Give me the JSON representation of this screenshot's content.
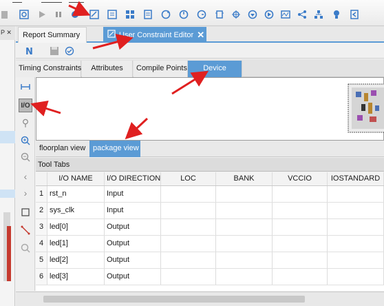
{
  "toolbar": {
    "icons": [
      "open-icon",
      "run-icon",
      "pause-icon",
      "settings-gear-icon",
      "edit-icon",
      "report-icon",
      "chip-icon",
      "hierarchy-icon",
      "document-icon",
      "refresh-icon",
      "cycle-icon",
      "clock-icon",
      "debug-icon",
      "bug-icon",
      "download-icon",
      "export-icon",
      "wave-icon",
      "share-icon",
      "tree-icon",
      "bulb-icon",
      "flag-icon"
    ]
  },
  "left_strip": {
    "header_text": "P ✕"
  },
  "tabs": {
    "report_summary": "Report Summary",
    "active_label": "User Constraint Editor",
    "close": "✕"
  },
  "editor_toolbar": {
    "icons": [
      "new-icon",
      "save-icon",
      "check-icon"
    ]
  },
  "subtabs": {
    "timing": "Timing Constraints",
    "attributes": "Attributes",
    "compile_points": "Compile Points",
    "device": "Device"
  },
  "vcol": {
    "io_label": "I/O"
  },
  "view_tabs": {
    "floorplan": "floorplan view",
    "package": "package view"
  },
  "tool_tabs": {
    "label": "Tool Tabs"
  },
  "table": {
    "headers": [
      "I/O NAME",
      "I/O DIRECTION",
      "LOC",
      "BANK",
      "VCCIO",
      "IOSTANDARD"
    ],
    "rows": [
      {
        "num": "1",
        "name": "rst_n",
        "dir": "Input"
      },
      {
        "num": "2",
        "name": "sys_clk",
        "dir": "Input"
      },
      {
        "num": "3",
        "name": "led[0]",
        "dir": "Output"
      },
      {
        "num": "4",
        "name": "led[1]",
        "dir": "Output"
      },
      {
        "num": "5",
        "name": "led[2]",
        "dir": "Output"
      },
      {
        "num": "6",
        "name": "led[3]",
        "dir": "Output"
      }
    ]
  },
  "colors": {
    "accent": "#5b9bd5",
    "arrow": "#e02020"
  }
}
